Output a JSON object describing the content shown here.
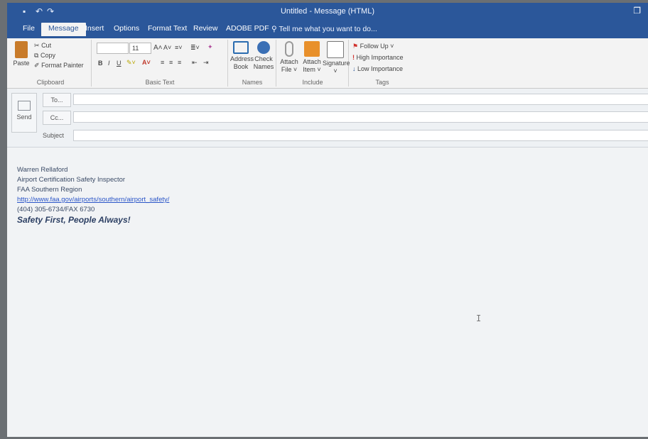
{
  "titlebar": {
    "title": "Untitled - Message (HTML)",
    "save_glyph": "▪",
    "undo_glyph": "↶",
    "redo_glyph": "↷",
    "restore_glyph": "❐"
  },
  "tabs": [
    {
      "label": "File"
    },
    {
      "label": "Message"
    },
    {
      "label": "Insert"
    },
    {
      "label": "Options"
    },
    {
      "label": "Format Text"
    },
    {
      "label": "Review"
    },
    {
      "label": "ADOBE PDF"
    }
  ],
  "tellme": {
    "icon": "lightbulb-icon",
    "text": "Tell me what you want to do..."
  },
  "ribbon": {
    "clipboard": {
      "paste": "Paste",
      "cut": "Cut",
      "copy": "Copy",
      "format_painter": "Format Painter",
      "label": "Clipboard"
    },
    "basic_text": {
      "font_name": "",
      "font_size": "11",
      "grow": "A˄",
      "shrink": "A˅",
      "bold": "B",
      "italic": "I",
      "underline": "U",
      "label": "Basic Text"
    },
    "names": {
      "address_book_1": "Address",
      "address_book_2": "Book",
      "check_names_1": "Check",
      "check_names_2": "Names",
      "label": "Names"
    },
    "include": {
      "attach_file_1": "Attach",
      "attach_file_2": "File ˅",
      "attach_item_1": "Attach",
      "attach_item_2": "Item ˅",
      "signature_1": "Signature",
      "signature_2": "˅",
      "label": "Include"
    },
    "tags": {
      "follow_up": "Follow Up ˅",
      "high_importance": "High Importance",
      "low_importance": "Low Importance",
      "label": "Tags"
    }
  },
  "compose": {
    "send_label": "Send",
    "to_label": "To...",
    "cc_label": "Cc...",
    "subject_label": "Subject",
    "to_value": "",
    "cc_value": "",
    "subject_value": ""
  },
  "signature": {
    "name": "Warren Rellaford",
    "title": "Airport Certification Safety Inspector",
    "region": "FAA Southern Region",
    "url": "http://www.faa.gov/airports/southern/airport_safety/",
    "phone": "(404) 305-6734/FAX 6730",
    "motto": "Safety First, People Always!"
  },
  "cursor_glyph": "I",
  "status": {
    "text": ""
  },
  "colors": {
    "accent": "#2b579a",
    "ribbon": "#f3f3f3",
    "link": "#2a55c8"
  }
}
